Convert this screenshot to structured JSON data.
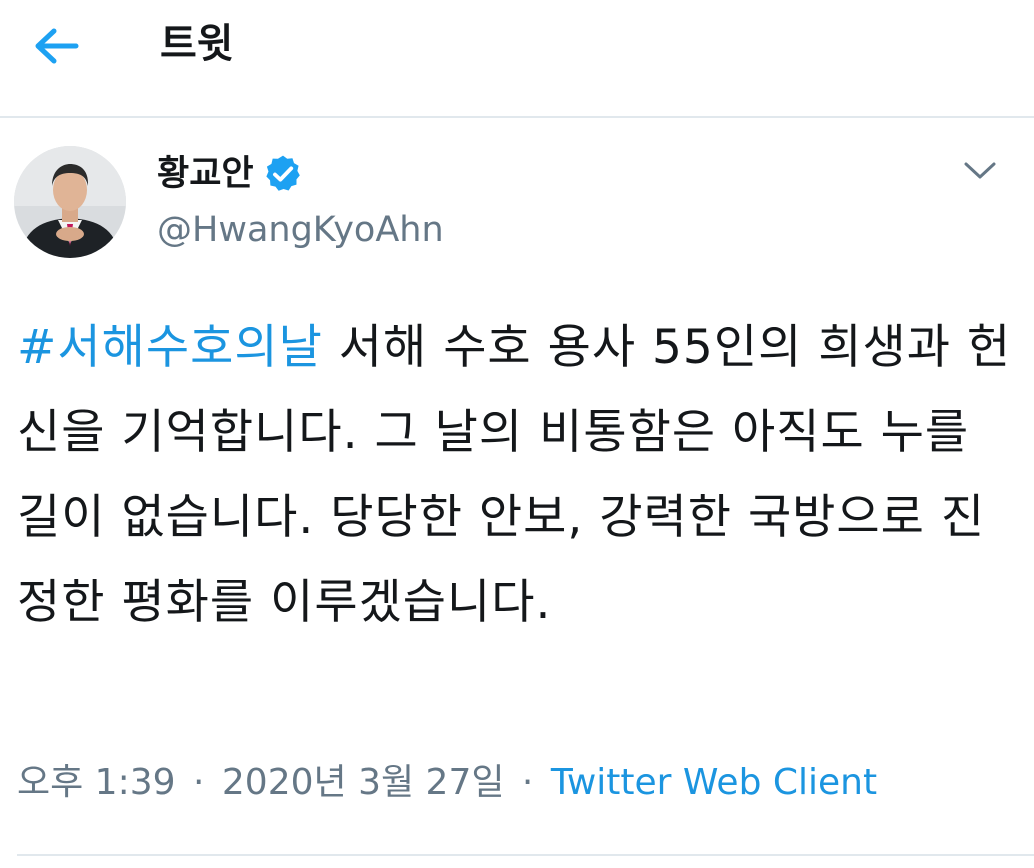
{
  "header": {
    "title": "트윗",
    "back_icon": "arrow-left-icon"
  },
  "tweet": {
    "author": {
      "display_name": "황교안",
      "handle": "@HwangKyoAhn",
      "verified": true,
      "avatar_icon": "profile-photo"
    },
    "menu_icon": "chevron-down-icon",
    "hashtag": "#서해수호의날",
    "text_after_hashtag": " 서해 수호 용사 55인의 희생과 헌신을 기억합니다. 그 날의 비통함은 아직도 누를 길이 없습니다. 당당한 안보, 강력한 국방으로 진정한 평화를 이루겠습니다.",
    "time": "오후 1:39",
    "date": "2020년 3월 27일",
    "separator": "·",
    "source": "Twitter Web Client"
  },
  "colors": {
    "accent": "#1b95e0",
    "verified": "#1da1f2",
    "muted": "#657786",
    "text": "#14171a",
    "divider": "#e1e8ed"
  }
}
